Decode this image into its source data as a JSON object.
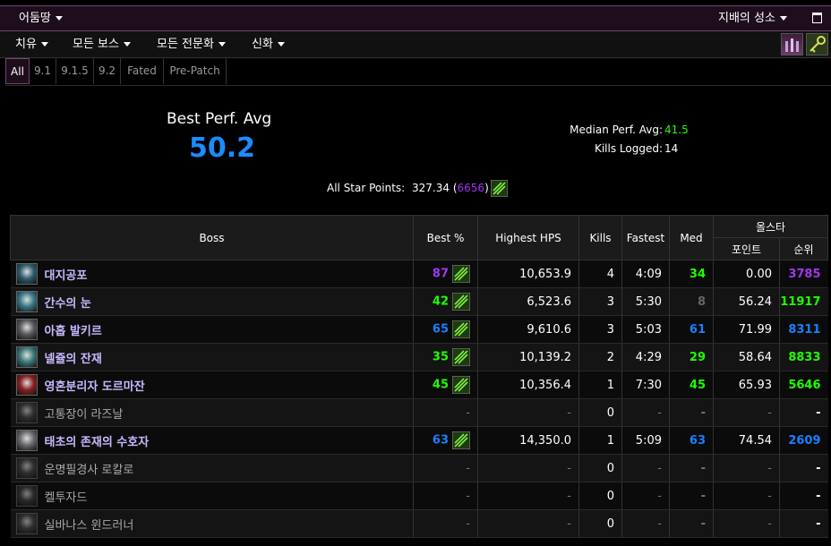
{
  "topbar": {
    "zone": "어둠땅",
    "raid": "지배의 성소"
  },
  "menu": {
    "role": "치유",
    "bosses": "모든 보스",
    "spec": "모든 전문화",
    "difficulty": "신화"
  },
  "tabs": [
    "All",
    "9.1",
    "9.1.5",
    "9.2",
    "Fated",
    "Pre-Patch"
  ],
  "summary": {
    "best_label": "Best Perf. Avg",
    "best_value": "50.2",
    "median_label": "Median Perf. Avg:",
    "median_value": "41.5",
    "kills_label": "Kills Logged:",
    "kills_value": "14",
    "star_label": "All Star Points:",
    "star_value": "327.34",
    "star_paren_open": "(",
    "star_rank": "6656",
    "star_paren_close": ")"
  },
  "columns": {
    "boss": "Boss",
    "best": "Best %",
    "hps": "Highest HPS",
    "kills": "Kills",
    "fastest": "Fastest",
    "med": "Med",
    "allstar": "올스타",
    "points": "포인트",
    "rank": "순위"
  },
  "colors": {
    "purple": "#a335ee",
    "blue": "#1a7fff",
    "green": "#1eff00",
    "gray": "#666666",
    "accent": "#6a4a68"
  },
  "rows": [
    {
      "name": "대지공포",
      "best": "87",
      "best_color": "#a335ee",
      "hps": "10,653.9",
      "kills": "4",
      "fastest": "4:09",
      "med": "34",
      "med_color": "#1eff00",
      "points": "0.00",
      "rank": "3785",
      "rank_color": "#a335ee",
      "icon": "#2d5e6e",
      "active": true
    },
    {
      "name": "간수의 눈",
      "best": "42",
      "best_color": "#1eff00",
      "hps": "6,523.6",
      "kills": "3",
      "fastest": "5:30",
      "med": "8",
      "med_color": "#666666",
      "points": "56.24",
      "rank": "11917",
      "rank_color": "#1eff00",
      "icon": "#3a7a8a",
      "active": true
    },
    {
      "name": "아홉 발키르",
      "best": "65",
      "best_color": "#1a7fff",
      "hps": "9,610.6",
      "kills": "3",
      "fastest": "5:03",
      "med": "61",
      "med_color": "#1a7fff",
      "points": "71.99",
      "rank": "8311",
      "rank_color": "#1a7fff",
      "icon": "#5a5a60",
      "active": true
    },
    {
      "name": "넬쥴의 잔재",
      "best": "35",
      "best_color": "#1eff00",
      "hps": "10,139.2",
      "kills": "2",
      "fastest": "4:29",
      "med": "29",
      "med_color": "#1eff00",
      "points": "58.64",
      "rank": "8833",
      "rank_color": "#1eff00",
      "icon": "#3d7a7a",
      "active": true
    },
    {
      "name": "영혼분리자 도르마잔",
      "best": "45",
      "best_color": "#1eff00",
      "hps": "10,356.4",
      "kills": "1",
      "fastest": "7:30",
      "med": "45",
      "med_color": "#1eff00",
      "points": "65.93",
      "rank": "5646",
      "rank_color": "#1eff00",
      "icon": "#8a2222",
      "active": true
    },
    {
      "name": "고통장이 라즈날",
      "best": "-",
      "best_color": "#777777",
      "hps": "-",
      "kills": "0",
      "fastest": "-",
      "med": "-",
      "med_color": "#777777",
      "points": "-",
      "rank": "-",
      "rank_color": "#ffffff",
      "icon": "#444444",
      "active": false
    },
    {
      "name": "태초의 존재의 수호자",
      "best": "63",
      "best_color": "#1a7fff",
      "hps": "14,350.0",
      "kills": "1",
      "fastest": "5:09",
      "med": "63",
      "med_color": "#1a7fff",
      "points": "74.54",
      "rank": "2609",
      "rank_color": "#1a7fff",
      "icon": "#6a6a70",
      "active": true
    },
    {
      "name": "운명필경사 로칼로",
      "best": "-",
      "best_color": "#777777",
      "hps": "-",
      "kills": "0",
      "fastest": "-",
      "med": "-",
      "med_color": "#777777",
      "points": "-",
      "rank": "-",
      "rank_color": "#ffffff",
      "icon": "#444444",
      "active": false
    },
    {
      "name": "켈투자드",
      "best": "-",
      "best_color": "#777777",
      "hps": "-",
      "kills": "0",
      "fastest": "-",
      "med": "-",
      "med_color": "#777777",
      "points": "-",
      "rank": "-",
      "rank_color": "#ffffff",
      "icon": "#444444",
      "active": false
    },
    {
      "name": "실바나스 윈드러너",
      "best": "-",
      "best_color": "#777777",
      "hps": "-",
      "kills": "0",
      "fastest": "-",
      "med": "-",
      "med_color": "#777777",
      "points": "-",
      "rank": "-",
      "rank_color": "#ffffff",
      "icon": "#444444",
      "active": false
    }
  ]
}
